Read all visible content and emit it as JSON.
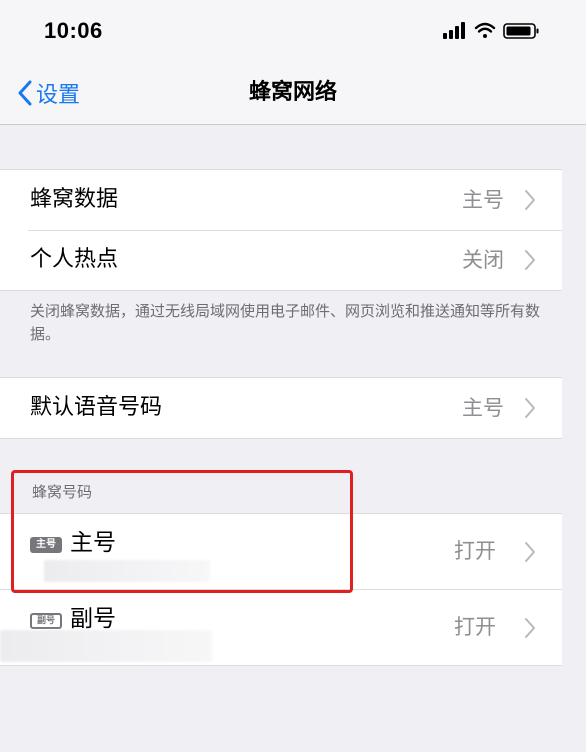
{
  "status_bar": {
    "time": "10:06"
  },
  "nav": {
    "back_label": "设置",
    "title": "蜂窝网络"
  },
  "group1": {
    "rows": [
      {
        "label": "蜂窝数据",
        "value": "主号"
      },
      {
        "label": "个人热点",
        "value": "关闭"
      }
    ],
    "footer": "关闭蜂窝数据，通过无线局域网使用电子邮件、网页浏览和推送通知等所有数据。"
  },
  "group2": {
    "rows": [
      {
        "label": "默认语音号码",
        "value": "主号"
      }
    ]
  },
  "sim_section": {
    "header": "蜂窝号码",
    "items": [
      {
        "badge": "主号",
        "label": "主号",
        "value": "打开"
      },
      {
        "badge": "副号",
        "label": "副号",
        "value": "打开"
      }
    ]
  },
  "colors": {
    "accent": "#1877f2",
    "highlight": "#e02020",
    "background": "#efeff4"
  },
  "icons": [
    "cellular-signal-icon",
    "wifi-icon",
    "battery-icon",
    "back-chevron-icon",
    "chevron-right-icon"
  ]
}
